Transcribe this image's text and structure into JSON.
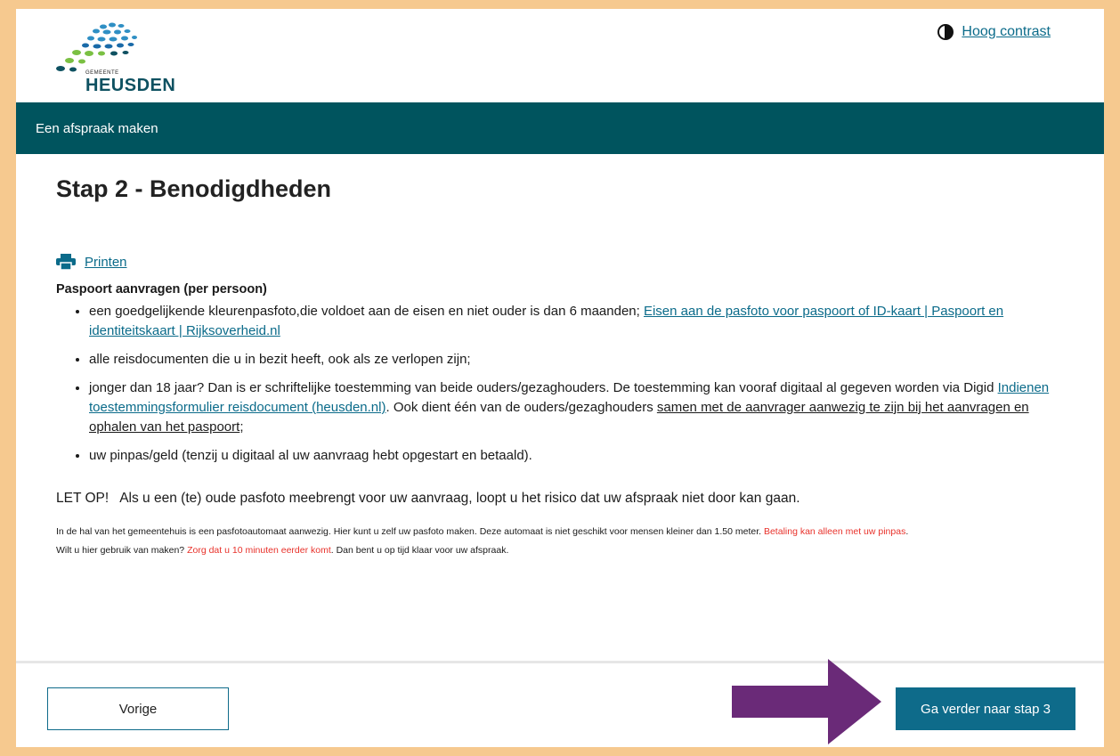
{
  "header": {
    "logo_small": "GEMEENTE",
    "logo_name": "HEUSDEN",
    "contrast_label": "Hoog contrast"
  },
  "nav": {
    "title": "Een afspraak maken"
  },
  "main": {
    "title": "Stap 2 - Benodigdheden",
    "print_label": "Printen",
    "section_title": "Paspoort aanvragen (per persoon)",
    "items": [
      {
        "text": "een goedgelijkende kleurenpasfoto,die voldoet aan de eisen en niet ouder is dan 6 maanden; ",
        "link": "Eisen aan de pasfoto voor paspoort of ID-kaart | Paspoort en identiteitskaart | Rijksoverheid.nl"
      },
      {
        "text": "alle reisdocumenten die u in bezit heeft, ook als ze verlopen zijn;"
      },
      {
        "text_a": "jonger dan 18 jaar? Dan is er schriftelijke toestemming van beide ouders/gezaghouders. De toestemming kan vooraf digitaal al gegeven worden via Digid ",
        "link": "Indienen toestemmingsformulier reisdocument (heusden.nl)",
        "text_b": ". Ook dient één van de ouders/gezaghouders ",
        "underlined": "samen met de aanvrager aanwezig te zijn bij het aanvragen en ophalen van het paspoort",
        "text_c": ";"
      },
      {
        "text": "uw pinpas/geld (tenzij u digitaal al uw aanvraag hebt opgestart en betaald)."
      }
    ],
    "letop": "LET OP!   Als u een (te) oude pasfoto meebrengt voor uw aanvraag, loopt u het risico dat uw afspraak niet door kan gaan.",
    "info_1a": "In de hal van het gemeentehuis is een pasfotoautomaat aanwezig. Hier kunt u zelf uw pasfoto maken. Deze automaat is niet geschikt voor mensen kleiner dan 1.50 meter. ",
    "info_1b": "Betaling kan alleen met uw pinpas",
    "info_1c": ".",
    "info_2a": "Wilt u hier gebruik van maken? ",
    "info_2b": "Zorg dat u 10 minuten eerder komt",
    "info_2c": ". Dan bent u op tijd klaar voor uw afspraak."
  },
  "footer": {
    "prev_label": "Vorige",
    "next_label": "Ga verder naar stap 3"
  },
  "colors": {
    "nav_bg": "#00545e",
    "button_bg": "#0e6b8a",
    "link": "#0b6b8a",
    "alert_red": "#e8322b",
    "arrow": "#6a2a78",
    "frame": "#f6c98f"
  }
}
